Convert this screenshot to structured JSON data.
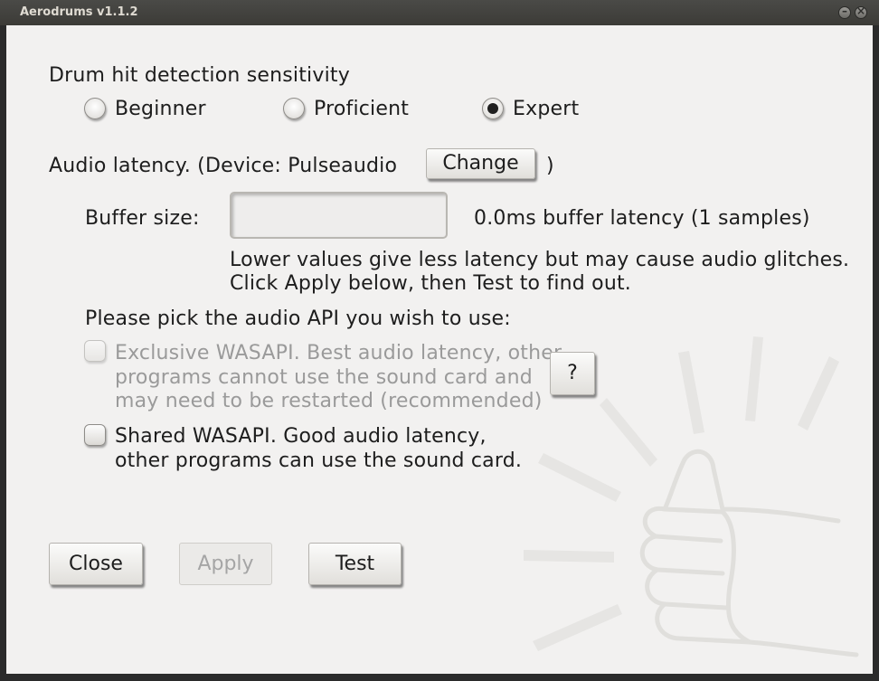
{
  "window": {
    "title": "Aerodrums v1.1.2"
  },
  "sensitivity": {
    "heading": "Drum hit detection sensitivity",
    "options": [
      {
        "label": "Beginner",
        "checked": false
      },
      {
        "label": "Proficient",
        "checked": false
      },
      {
        "label": "Expert",
        "checked": true
      }
    ]
  },
  "latency": {
    "label": "Audio latency.  (Device: Pulseaudio",
    "change_button": "Change",
    "close_paren": ")",
    "buffer_label": "Buffer size:",
    "buffer_value": "",
    "buffer_info": "0.0ms buffer latency (1 samples)",
    "hint_line1": "Lower values give less latency but may cause audio glitches.",
    "hint_line2": "Click Apply below, then Test to find out."
  },
  "audio_api": {
    "heading": "Please pick the audio API you wish to use:",
    "exclusive": {
      "line1": "Exclusive WASAPI. Best audio latency, other",
      "line2": "programs cannot use the sound card and",
      "line3": "may need to be restarted (recommended)",
      "enabled": false,
      "checked": false
    },
    "help_button": "?",
    "shared": {
      "line1": "Shared WASAPI. Good audio latency,",
      "line2": "other programs can use the sound card.",
      "checked": false
    }
  },
  "buttons": {
    "close": "Close",
    "apply": "Apply",
    "test": "Test"
  },
  "colors": {
    "background": "#f2f1f0",
    "titlebar": "#3c3b37",
    "text": "#1d1d1d",
    "disabled_text": "#9a9a9a"
  }
}
